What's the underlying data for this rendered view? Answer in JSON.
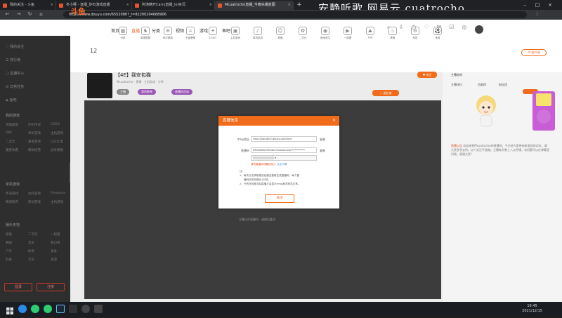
{
  "browser": {
    "tabs": [
      {
        "label": "我的关注 - 斗鱼",
        "active": false
      },
      {
        "label": "冬小狮 - 直播_炉石游戏直播",
        "active": false
      },
      {
        "label": "阿涛精开Carry直播_lol实况",
        "active": false
      },
      {
        "label": "Mcuatrocho直播_今晚先播蓝图",
        "active": true
      }
    ],
    "url": "https://www.douyu.com/6552080?_t=82200204068906",
    "watermark": "安静听歌 网易云 cuatrocho"
  },
  "site": {
    "logo": "斗鱼",
    "nav": [
      "首页",
      "直播",
      "分类",
      "视频",
      "游戏",
      "鱼吧"
    ],
    "active_nav": "直播",
    "room_count": "12",
    "categories": [
      "分类",
      "英雄联盟",
      "和平精英",
      "王者荣耀",
      "CSGO",
      "主机游戏",
      "单机热游",
      "颜值",
      "二次元",
      "绝地求生",
      "一起看",
      "户外",
      "美食",
      "科技",
      "体育"
    ]
  },
  "sidebar": {
    "items": [
      "我的关注",
      "排行榜",
      "直播中心",
      "日常任务",
      "鱼吧"
    ],
    "section1": "我的游戏",
    "grid1": [
      "英雄联盟",
      "炉石传说",
      "CSGO",
      "DNF",
      "单机游戏",
      "主机游戏",
      "二次元",
      "暴雪游戏",
      "LOL云顶",
      "魔兽争霸",
      "模拟经营",
      "战争策略"
    ],
    "section2": "单机游戏",
    "grid2": [
      "怀旧游戏",
      "动作游戏",
      "Fireworks",
      "赛博朋克",
      "原创游戏",
      "主机游戏"
    ],
    "section3": "娱乐天地",
    "grid3": [
      "颜值",
      "二次元",
      "一起看",
      "舞蹈",
      "音乐",
      "脱口秀",
      "户外",
      "体育",
      "美食",
      "科技",
      "汽车",
      "旅游"
    ],
    "btn_login": "登录",
    "btn_register": "注册"
  },
  "room": {
    "title": "【4E】我安包猫",
    "subtitle": "Mcuatrocho · 直播 · 主机游戏 · 分享",
    "tags": [
      "主播",
      "我的歌单",
      "直播间活动"
    ],
    "level": "4E",
    "player_hint": "主播正在直播中，请稍后重试"
  },
  "right_col": {
    "header": "主播房间",
    "links": [
      "主播排行",
      "贡献榜",
      "粉丝团"
    ],
    "notice_title": "直播公告",
    "notice_text": "欢迎来到Mcuatrocho的直播间。今天给大家带来新游戏的试玩，请大家多多支持，点个关注不迷路。主播每天晚上八点开播，有问题可以在弹幕里问我，谢谢大家！"
  },
  "dialog": {
    "title": "直播信息",
    "rtmp_label": "rtmp地址",
    "rtmp_value": "rtmp://sendtc3.douyu.com/live",
    "stream_label": "直播码",
    "stream_value": "6552080rEYEx6ck7vxDacnetx***********",
    "copy_label": "复制",
    "warn_text": "请勿直播码泄露给他人",
    "warn_link": "点击了解",
    "notes": [
      "注：",
      "1、每次点击获取推流后都会重新生成直播码，每个直",
      "播码仅有效期为1分钟。",
      "2、只有在线推流后直播才会显示rtmp推流状态正常。"
    ],
    "ok_label": "关闭"
  },
  "taskbar": {
    "time": "16:45",
    "date": "2021/12/15"
  },
  "colors": {
    "accent": "#f06b1a",
    "logo": "#f06a2c",
    "sidebar_bg": "#2e2e2e",
    "player_bg": "#3c3c3c"
  }
}
